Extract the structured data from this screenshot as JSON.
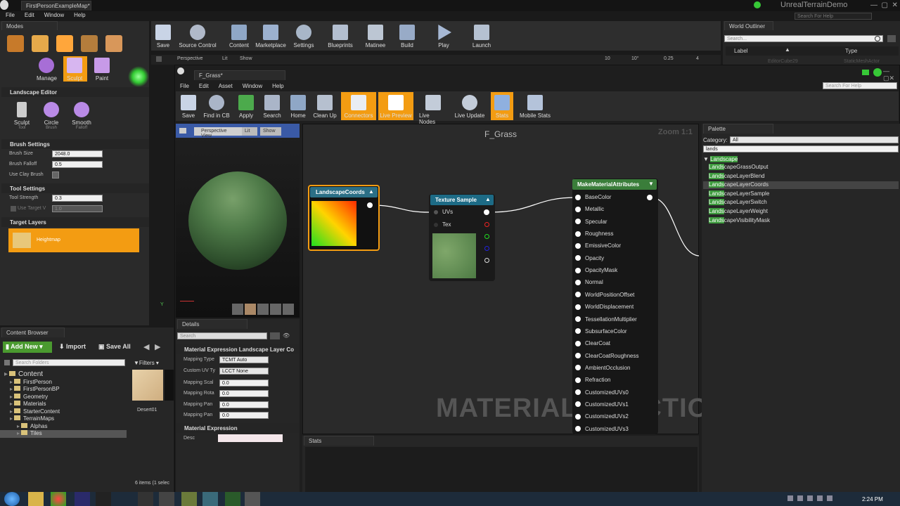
{
  "main": {
    "title": "FirstPersonExampleMap*",
    "project": "UnrealTerrainDemo",
    "search_help": "Search For Help",
    "menu": [
      "File",
      "Edit",
      "Window",
      "Help"
    ]
  },
  "modes": {
    "tab": "Modes",
    "buttons": [
      "Manage",
      "Sculpt",
      "Paint"
    ]
  },
  "landscape": {
    "header": "Landscape Editor",
    "tools": [
      {
        "label": "Sculpt",
        "sub": "Tool"
      },
      {
        "label": "Circle",
        "sub": "Brush"
      },
      {
        "label": "Smooth",
        "sub": "Falloff"
      }
    ],
    "brush_header": "Brush Settings",
    "brush_size_label": "Brush Size",
    "brush_size": "2048.0",
    "brush_falloff_label": "Brush Falloff",
    "brush_falloff": "0.5",
    "use_clay_label": "Use Clay Brush",
    "tool_header": "Tool Settings",
    "tool_strength_label": "Tool Strength",
    "tool_strength": "0.3",
    "use_target_label": "Use Target V",
    "use_target": "1.0",
    "target_header": "Target Layers",
    "heightmap": "Heightmap"
  },
  "main_toolbar": [
    "Save",
    "Source Control",
    "Content",
    "Marketplace",
    "Settings",
    "Blueprints",
    "Matinee",
    "Build",
    "Play",
    "Launch"
  ],
  "viewport_bar": {
    "perspective": "Perspective",
    "lit": "Lit",
    "show": "Show",
    "grid": "10",
    "angle": "10°",
    "scale": "0.25",
    "cam": "4"
  },
  "outliner": {
    "tab": "World Outliner",
    "search_placeholder": "Search...",
    "col_label": "Label",
    "col_type": "Type",
    "row": "EditorCube29",
    "row_type": "StaticMeshActor"
  },
  "content_browser": {
    "tab": "Content Browser",
    "add_new": "Add New",
    "import": "Import",
    "save_all": "Save All",
    "search_folders": "Search Folders",
    "filters": "Filters",
    "folders": [
      "Content",
      "FirstPerson",
      "FirstPersonBP",
      "Geometry",
      "Materials",
      "StarterContent",
      "TerrainMaps",
      "Alphas",
      "Tiles"
    ],
    "asset": "Desert01",
    "count": "6 items (1 selec"
  },
  "mat_editor": {
    "tab": "F_Grass*",
    "menu": [
      "File",
      "Edit",
      "Asset",
      "Window",
      "Help"
    ],
    "search_help": "Search For Help",
    "toolbar": [
      "Save",
      "Find in CB",
      "Apply",
      "Search",
      "Home",
      "Clean Up",
      "Connectors",
      "Live Preview",
      "Live Nodes",
      "Live Update",
      "Stats",
      "Mobile Stats"
    ]
  },
  "preview": {
    "perspective": "Perspective",
    "view": "View",
    "lit": "Lit",
    "show": "Show",
    "axis_y": "Y"
  },
  "details": {
    "tab": "Details",
    "search_placeholder": "Search",
    "section": "Material Expression Landscape Layer Co",
    "rows": [
      {
        "label": "Mapping Type",
        "value": "TCMT Auto"
      },
      {
        "label": "Custom UV Ty",
        "value": "LCCT None"
      },
      {
        "label": "Mapping Scal",
        "value": "0.0"
      },
      {
        "label": "Mapping Rota",
        "value": "0.0"
      },
      {
        "label": "Mapping Pan",
        "value": "0.0"
      },
      {
        "label": "Mapping Pan",
        "value": "0.0"
      }
    ],
    "section2": "Material Expression",
    "desc_label": "Desc"
  },
  "graph": {
    "title": "F_Grass",
    "zoom": "Zoom 1:1",
    "watermark": "MATERIAL FUNCTION",
    "node_coords": "LandscapeCoords",
    "node_tex": "Texture Sample",
    "tex_pins": [
      "UVs",
      "Tex"
    ],
    "node_make": "MakeMaterialAttributes",
    "pins": [
      "BaseColor",
      "Metallic",
      "Specular",
      "Roughness",
      "EmissiveColor",
      "Opacity",
      "OpacityMask",
      "Normal",
      "WorldPositionOffset",
      "WorldDisplacement",
      "TessellationMultiplier",
      "SubsurfaceColor",
      "ClearCoat",
      "ClearCoatRoughness",
      "AmbientOcclusion",
      "Refraction",
      "CustomizedUVs0",
      "CustomizedUVs1",
      "CustomizedUVs2",
      "CustomizedUVs3"
    ]
  },
  "stats": {
    "tab": "Stats"
  },
  "palette": {
    "tab": "Palette",
    "category_label": "Category:",
    "category": "All",
    "search": "lands",
    "group": "Landscape",
    "items": [
      {
        "hl": "Lands",
        "rest": "capeGrassOutput"
      },
      {
        "hl": "Lands",
        "rest": "capeLayerBlend"
      },
      {
        "hl": "Lands",
        "rest": "capeLayerCoords"
      },
      {
        "hl": "Lands",
        "rest": "capeLayerSample"
      },
      {
        "hl": "Lands",
        "rest": "capeLayerSwitch"
      },
      {
        "hl": "Lands",
        "rest": "capeLayerWeight"
      },
      {
        "hl": "Lands",
        "rest": "capeVisibilityMask"
      }
    ]
  },
  "taskbar": {
    "time": "2:24 PM"
  },
  "colors": {
    "accent": "#f39c12",
    "node_teal": "#1d6b86",
    "node_green": "#3a7d3a",
    "highlight": "#3d9b3d"
  }
}
